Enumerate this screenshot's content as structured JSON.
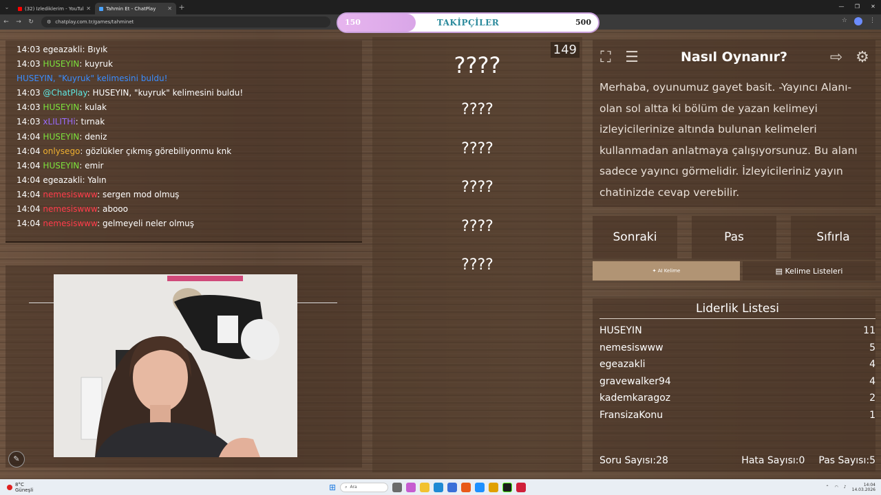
{
  "browser": {
    "tabs": [
      {
        "title": "(32) İzlediklerim - YouTube",
        "favicon_color": "#ff0000"
      },
      {
        "title": "Tahmin Et - ChatPlay",
        "favicon_color": "#4aa3ff"
      }
    ],
    "url": "chatplay.com.tr/games/tahminet",
    "new_tab": "+"
  },
  "followers": {
    "current": "150",
    "label": "TAKİPÇİLER",
    "goal": "500",
    "progress_fraction": 0.3
  },
  "chat": {
    "messages": [
      {
        "time": "14:03",
        "user": "egeazakli",
        "color": "#ffffff",
        "text": ": Bıyık"
      },
      {
        "time": "14:03",
        "user": "HUSEYIN",
        "color": "#7ce23c",
        "text": ": kuyruk"
      },
      {
        "time": "",
        "user": "HUSEYIN, \"Kuyruk\" kelimesini buldu!",
        "color": "#3a8dff",
        "text": ""
      },
      {
        "time": "14:03",
        "user": "@ChatPlay",
        "color": "#5ee8e2",
        "text": ": HUSEYIN, \"kuyruk\" kelimesini buldu!"
      },
      {
        "time": "14:03",
        "user": "HUSEYIN",
        "color": "#7ce23c",
        "text": ": kulak"
      },
      {
        "time": "14:03",
        "user": "xLILITHi",
        "color": "#9b6cff",
        "text": ": tırnak"
      },
      {
        "time": "14:04",
        "user": "HUSEYIN",
        "color": "#7ce23c",
        "text": ": deniz"
      },
      {
        "time": "14:04",
        "user": "onlysego",
        "color": "#f0b030",
        "text": ": gözlükler çıkmış görebiliyonmu knk"
      },
      {
        "time": "14:04",
        "user": "HUSEYIN",
        "color": "#7ce23c",
        "text": ": emir"
      },
      {
        "time": "14:04",
        "user": "egeazakli",
        "color": "#ffffff",
        "text": ": Yalın"
      },
      {
        "time": "14:04",
        "user": "nemesiswww",
        "color": "#ff3b4a",
        "text": ": sergen mod olmuş"
      },
      {
        "time": "14:04",
        "user": "nemesiswww",
        "color": "#ff3b4a",
        "text": ": abooo"
      },
      {
        "time": "14:04",
        "user": "nemesiswww",
        "color": "#ff3b4a",
        "text": ": gelmeyeli neler olmuş"
      }
    ]
  },
  "game": {
    "counter": "149",
    "main_word": "????",
    "hidden_words": [
      "????",
      "????",
      "????",
      "????",
      "????"
    ]
  },
  "howto": {
    "title": "Nasıl Oynanır?",
    "text": "Merhaba, oyunumuz gayet basit. -Yayıncı Alanı- olan sol altta ki bölüm de yazan kelimeyi izleyicilerinize altında bulunan kelimeleri kullanmadan anlatmaya çalışıyorsunuz. Bu alanı sadece yayıncı görmelidir. İzleyicileriniz yayın chatinizde cevap verebilir."
  },
  "controls": {
    "next": "Sonraki",
    "pass": "Pas",
    "reset": "Sıfırla",
    "ai_tab": "✦ AI Kelime",
    "list_tab": "Kelime Listeleri"
  },
  "leaderboard": {
    "title": "Liderlik Listesi",
    "rows": [
      {
        "name": "HUSEYIN",
        "score": "11"
      },
      {
        "name": "nemesiswww",
        "score": "5"
      },
      {
        "name": "egeazakli",
        "score": "4"
      },
      {
        "name": "gravewalker94",
        "score": "4"
      },
      {
        "name": "kademkaragoz",
        "score": "2"
      },
      {
        "name": "FransizaKonu",
        "score": "1"
      }
    ],
    "questions_label": "Soru Sayısı:",
    "questions_value": "28",
    "errors_label": "Hata Sayısı:",
    "errors_value": "0",
    "passes_label": "Pas Sayısı:",
    "passes_value": "5"
  },
  "taskbar": {
    "weather_temp": "8°C",
    "weather_desc": "Güneşli",
    "search_placeholder": "Ara",
    "time": "14:04",
    "date": "14.03.2026"
  },
  "icons": {
    "fullscreen": "fullscreen-icon",
    "notes": "notes-icon",
    "exit": "exit-icon",
    "settings": "gear-icon"
  }
}
